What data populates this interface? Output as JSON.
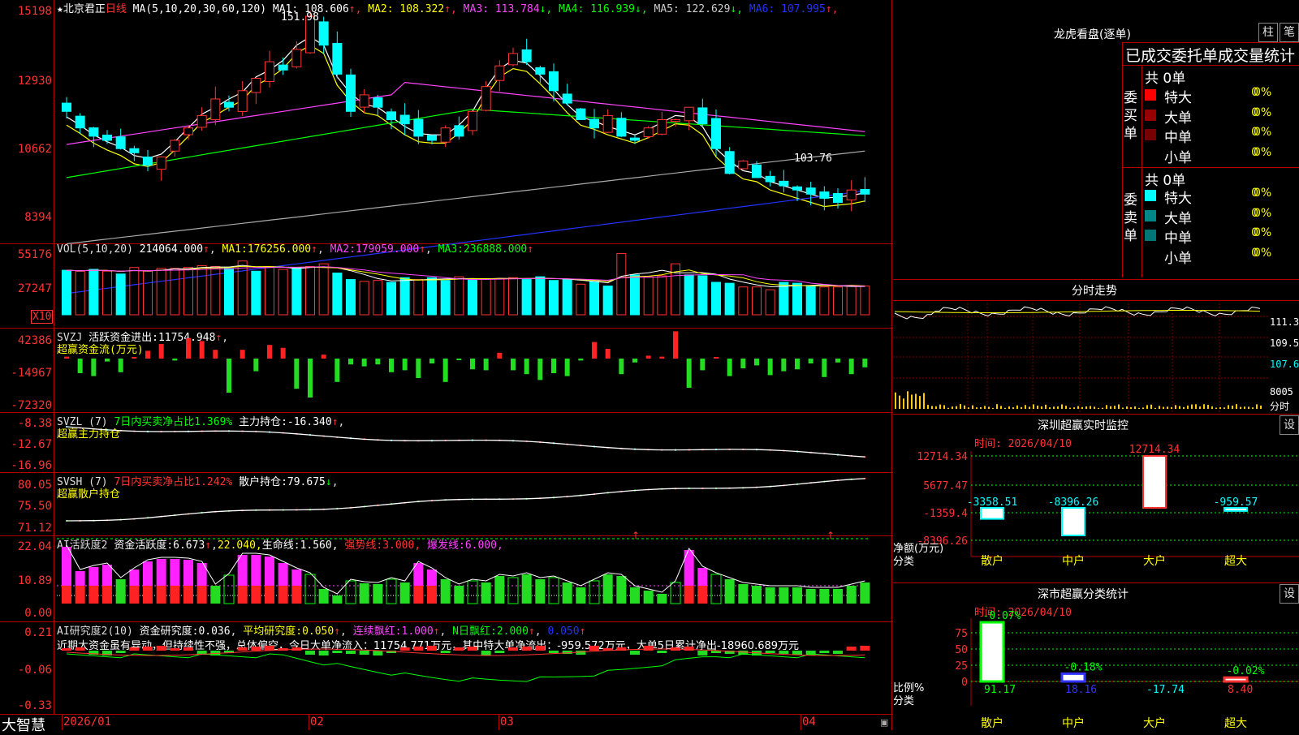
{
  "title": {
    "stock": "★北京君正",
    "period": "日线"
  },
  "price": {
    "ma_label": "MA(5,10,20,30,60,120)",
    "ma": [
      {
        "k": "MA1:",
        "v": "108.606",
        "arr": "↑",
        "c": "#ffffff"
      },
      {
        "k": "MA2:",
        "v": "108.322",
        "arr": "↑",
        "c": "#ffff00"
      },
      {
        "k": "MA3:",
        "v": "113.784",
        "arr": "↓",
        "c": "#ff44ff"
      },
      {
        "k": "MA4:",
        "v": "116.939",
        "arr": "↓",
        "c": "#00ff00"
      },
      {
        "k": "MA5:",
        "v": "122.629",
        "arr": "↓",
        "c": "#cccccc"
      },
      {
        "k": "MA6:",
        "v": "107.995",
        "arr": "↑",
        "c": "#2233ff"
      }
    ],
    "high_label": "151.98",
    "low_label": "103.76",
    "y_ticks": [
      "15198",
      "12930",
      "10662",
      "8394"
    ]
  },
  "vol": {
    "label": "VOL(5,10,20)",
    "value": "214064.000",
    "ma": [
      {
        "k": "MA1:",
        "v": "176256.000",
        "c": "#ffff00"
      },
      {
        "k": "MA2:",
        "v": "179059.000",
        "c": "#ff44ff"
      },
      {
        "k": "MA3:",
        "v": "236888.000",
        "c": "#00ff00"
      }
    ],
    "y_ticks": [
      "55176",
      "27247"
    ],
    "unit": "X10",
    "values": [
      48,
      47,
      49,
      47,
      44,
      51,
      47,
      50,
      50,
      51,
      53,
      52,
      50,
      58,
      47,
      52,
      49,
      51,
      52,
      55,
      45,
      38,
      36,
      37,
      35,
      40,
      38,
      40,
      37,
      41,
      38,
      39,
      39,
      40,
      38,
      41,
      37,
      38,
      33,
      36,
      31,
      66,
      43,
      41,
      42,
      55,
      43,
      42,
      35,
      34,
      30,
      30,
      27,
      35,
      34,
      31,
      30,
      30,
      31,
      31
    ]
  },
  "svzj": {
    "label": "SVZJ",
    "label2": "活跃资金进出:",
    "value": "11754.948",
    "name": "超赢资金流(万元)",
    "y_ticks": [
      "42386",
      "-14967",
      "-72320"
    ],
    "values": [
      2,
      -15,
      -18,
      -3,
      -14,
      1,
      8,
      15,
      -2,
      21,
      18,
      9,
      -35,
      9,
      -13,
      14,
      11,
      -31,
      -40,
      4,
      -24,
      -6,
      -8,
      -6,
      -14,
      -12,
      -20,
      -5,
      -24,
      -1,
      -11,
      -12,
      6,
      -12,
      -16,
      -22,
      -15,
      -18,
      -2,
      17,
      10,
      -16,
      -4,
      3,
      2,
      28,
      -30,
      -12,
      0,
      -18,
      -10,
      -7,
      -17,
      -13,
      -11,
      -5,
      -19,
      -4,
      -16,
      -9
    ]
  },
  "svzl": {
    "label": "SVZL (7)",
    "t1": "7日内买卖净占比1.369%",
    "t2": "主力持仓:",
    "value": "-16.340",
    "name": "超赢主力持仓",
    "y_ticks": [
      "-8.38",
      "-12.67",
      "-16.96"
    ]
  },
  "svsh": {
    "label": "SVSH (7)",
    "t1": "7日内买卖净占比1.242%",
    "t2": "散户持仓:",
    "value": "79.675",
    "name": "超赢散户持仓",
    "y_ticks": [
      "80.05",
      "75.50",
      "71.12"
    ]
  },
  "ai1": {
    "label": "AI活跃度2",
    "t1": "资金活跃度:",
    "v1": "6.673",
    "v2": "22.040,",
    "t3": "生命线:",
    "v3": "1.560,",
    "t4": "强势线:",
    "v4": "3.000,",
    "t5": "爆发线:",
    "v5": "6.000,",
    "y_ticks": [
      "22.04",
      "10.89",
      "0.00"
    ]
  },
  "ai2": {
    "label": "AI研究度2(10)",
    "t1": "资金研究度:",
    "v1": "0.036",
    "t2": "平均研究度:",
    "v2": "0.050",
    "t3": "连续飘红:",
    "v3": "1.000",
    "t4": "N日飘红:",
    "v4": "2.000",
    "v5": "0.050",
    "text": "近期大资金虽有异动，但持续性不强，总体偏空，今日大单净流入：11754.771万元，其中特大单净流出：-959.572万元，大单5日累计净出-18960.689万元",
    "y_ticks": [
      "0.21",
      "-0.06",
      "-0.33"
    ]
  },
  "x_axis": {
    "dates": [
      "2026/01",
      "02",
      "03",
      "04"
    ]
  },
  "bottom_left": "大智慧",
  "right": {
    "longhu_title": "龙虎看盘(逐单)",
    "btn_zhu": "柱",
    "btn_bi": "笔",
    "stat_title": "已成交委托单成交量统计",
    "buy_label": "委买单",
    "sell_label": "委卖单",
    "buy_total": "共 0单",
    "sell_total": "共 0单",
    "buy_rows": [
      {
        "name": "特大",
        "n": "0",
        "p": "0%",
        "c": "#ff0000"
      },
      {
        "name": "大单",
        "n": "0",
        "p": "0%",
        "c": "#990000"
      },
      {
        "name": "中单",
        "n": "0",
        "p": "0%",
        "c": "#770000"
      },
      {
        "name": "小单",
        "n": "0",
        "p": "0%",
        "c": "#000000"
      }
    ],
    "sell_rows": [
      {
        "name": "特大",
        "n": "0",
        "p": "0%",
        "c": "#00ffff"
      },
      {
        "name": "大单",
        "n": "0",
        "p": "0%",
        "c": "#008888"
      },
      {
        "name": "中单",
        "n": "0",
        "p": "0%",
        "c": "#007777"
      },
      {
        "name": "小单",
        "n": "0",
        "p": "0%",
        "c": "#000000"
      }
    ],
    "fenshi_title": "分时走势",
    "fenshi_ticks": [
      "111.3",
      "109.5",
      "107.6",
      "8005",
      "分时"
    ],
    "sz_title": "深圳超赢实时监控",
    "sz_time": "时间: 2026/04/10",
    "sz_btn": "设",
    "sz_chart": {
      "categories": [
        "散户",
        "中户",
        "大户",
        "超大"
      ],
      "values": [
        -3358.51,
        -8396.26,
        12714.34,
        -959.57
      ],
      "y_ticks": [
        "12714.34",
        "5677.47",
        "-1359.4",
        "-8396.26"
      ],
      "ylabel": "净额(万元)",
      "xlabel": "分类"
    },
    "ss_title": "深市超赢分类统计",
    "ss_time": "时间: 2026/04/10",
    "ss_btn": "设",
    "ss_chart": {
      "categories": [
        "散户",
        "中户",
        "大户",
        "超大"
      ],
      "values": [
        91.17,
        18.16,
        -17.74,
        8.4
      ],
      "top_labels": [
        "-0.07%",
        "-0.18%",
        "",
        "-0.02%"
      ],
      "y_ticks": [
        "75",
        "50",
        "25",
        "0"
      ],
      "ylabel": "比例%",
      "xlabel": "分类"
    }
  }
}
